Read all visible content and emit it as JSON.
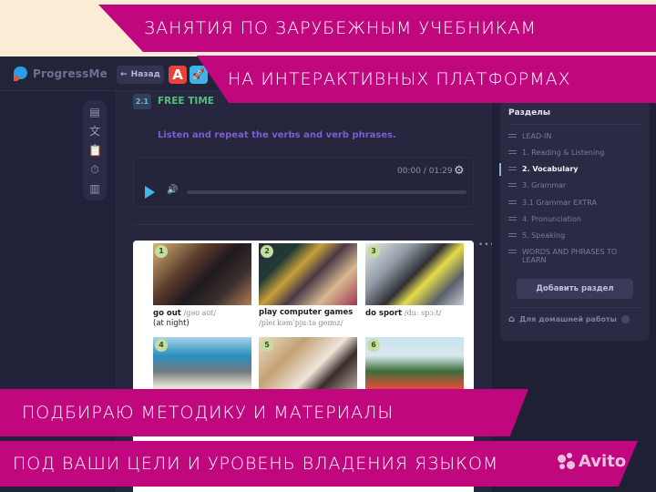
{
  "app": {
    "logo_text": "ProgressMe",
    "back_label": "Назад",
    "back_arrow": "←",
    "app_icon_a": "A",
    "app_icon_rocket": "🚀"
  },
  "tools": [
    {
      "name": "chat-icon",
      "glyph": "▤"
    },
    {
      "name": "translate-icon",
      "glyph": "文"
    },
    {
      "name": "clipboard-icon",
      "glyph": "📋"
    },
    {
      "name": "timer-icon",
      "glyph": "⏱"
    },
    {
      "name": "layout-icon",
      "glyph": "▥"
    }
  ],
  "lesson": {
    "number": "2.1",
    "title": "FREE TIME",
    "instruction": "Listen and repeat the verbs and verb phrases."
  },
  "player": {
    "time": "00:00 / 01:29",
    "progress": 0,
    "gear": "⚙",
    "volume": "🔊"
  },
  "book": {
    "more": "•••",
    "items": [
      {
        "num": "1",
        "phrase": "go out",
        "ipa": "/gəʊ aʊt/",
        "extra": "(at night)"
      },
      {
        "num": "2",
        "phrase": "play computer games",
        "ipa": "/pleɪ kəmˈpjuːtə geɪmz/"
      },
      {
        "num": "3",
        "phrase": "do sport",
        "ipa": "/duː spɔːt/"
      },
      {
        "num": "4"
      },
      {
        "num": "5"
      },
      {
        "num": "6"
      }
    ]
  },
  "sections": {
    "title": "Разделы",
    "items": [
      {
        "label": "LEAD-IN"
      },
      {
        "label": "1. Reading & Listening"
      },
      {
        "label": "2. Vocabulary",
        "active": true
      },
      {
        "label": "3. Grammar"
      },
      {
        "label": "3.1 Grammar EXTRA"
      },
      {
        "label": "4. Pronunciation"
      },
      {
        "label": "5. Speaking"
      },
      {
        "label": "WORDS AND PHRASES TO LEARN"
      }
    ],
    "add_label": "Добавить раздел",
    "homework_label": "Для домашней работы",
    "home_icon": "⌂"
  },
  "banners": {
    "line1": "ЗАНЯТИЯ ПО ЗАРУБЕЖНЫМ УЧЕБНИКАМ",
    "line2": "НА ИНТЕРАКТИВНЫХ ПЛАТФОРМАХ",
    "line3": "ПОДБИРАЮ МЕТОДИКУ И МАТЕРИАЛЫ",
    "line4": "ПОД ВАШИ ЦЕЛИ И УРОВЕНЬ ВЛАДЕНИЯ ЯЗЫКОМ"
  },
  "watermark": "Avito",
  "colors": {
    "banner": "#c0077e",
    "background": "#fbecd6",
    "app_bg": "#22223a",
    "accent_green": "#4fc07a",
    "accent_purple": "#7a5fd0",
    "accent_blue": "#3fb8ec"
  }
}
